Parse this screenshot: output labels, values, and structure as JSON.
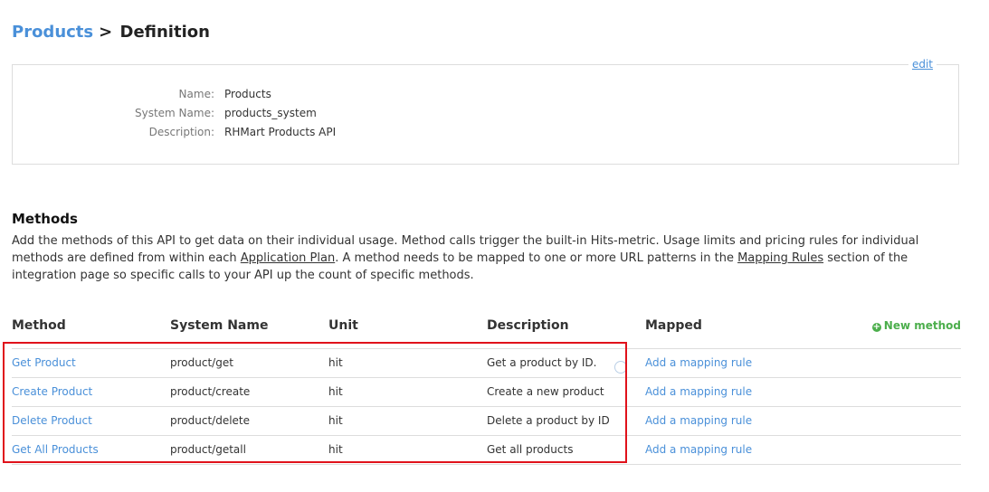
{
  "breadcrumb": {
    "parent": "Products",
    "separator": ">",
    "current": "Definition"
  },
  "definition": {
    "edit_label": "edit",
    "fields": [
      {
        "label": "Name:",
        "value": "Products"
      },
      {
        "label": "System Name:",
        "value": "products_system"
      },
      {
        "label": "Description:",
        "value": "RHMart Products API"
      }
    ]
  },
  "methods": {
    "title": "Methods",
    "description": {
      "part1": "Add the methods of this API to get data on their individual usage. Method calls trigger the built-in Hits-metric. Usage limits and pricing rules for individual methods are defined from within each ",
      "link1": "Application Plan",
      "part2": ". A method needs to be mapped to one or more URL patterns in the ",
      "link2": "Mapping Rules",
      "part3": " section of the integration page so specific calls to your API up the count of specific methods."
    },
    "new_method_label": "New method",
    "columns": [
      "Method",
      "System Name",
      "Unit",
      "Description",
      "Mapped"
    ],
    "rows": [
      {
        "method": "Get Product",
        "system_name": "product/get",
        "unit": "hit",
        "description": "Get a product by ID.",
        "mapped": "Add a mapping rule"
      },
      {
        "method": "Create Product",
        "system_name": "product/create",
        "unit": "hit",
        "description": "Create a new product",
        "mapped": "Add a mapping rule"
      },
      {
        "method": "Delete Product",
        "system_name": "product/delete",
        "unit": "hit",
        "description": "Delete a product by ID",
        "mapped": "Add a mapping rule"
      },
      {
        "method": "Get All Products",
        "system_name": "product/getall",
        "unit": "hit",
        "description": "Get all products",
        "mapped": "Add a mapping rule"
      }
    ]
  },
  "colors": {
    "link": "#4a90d9",
    "new_method": "#4cae4c",
    "highlight": "#e0121b"
  }
}
